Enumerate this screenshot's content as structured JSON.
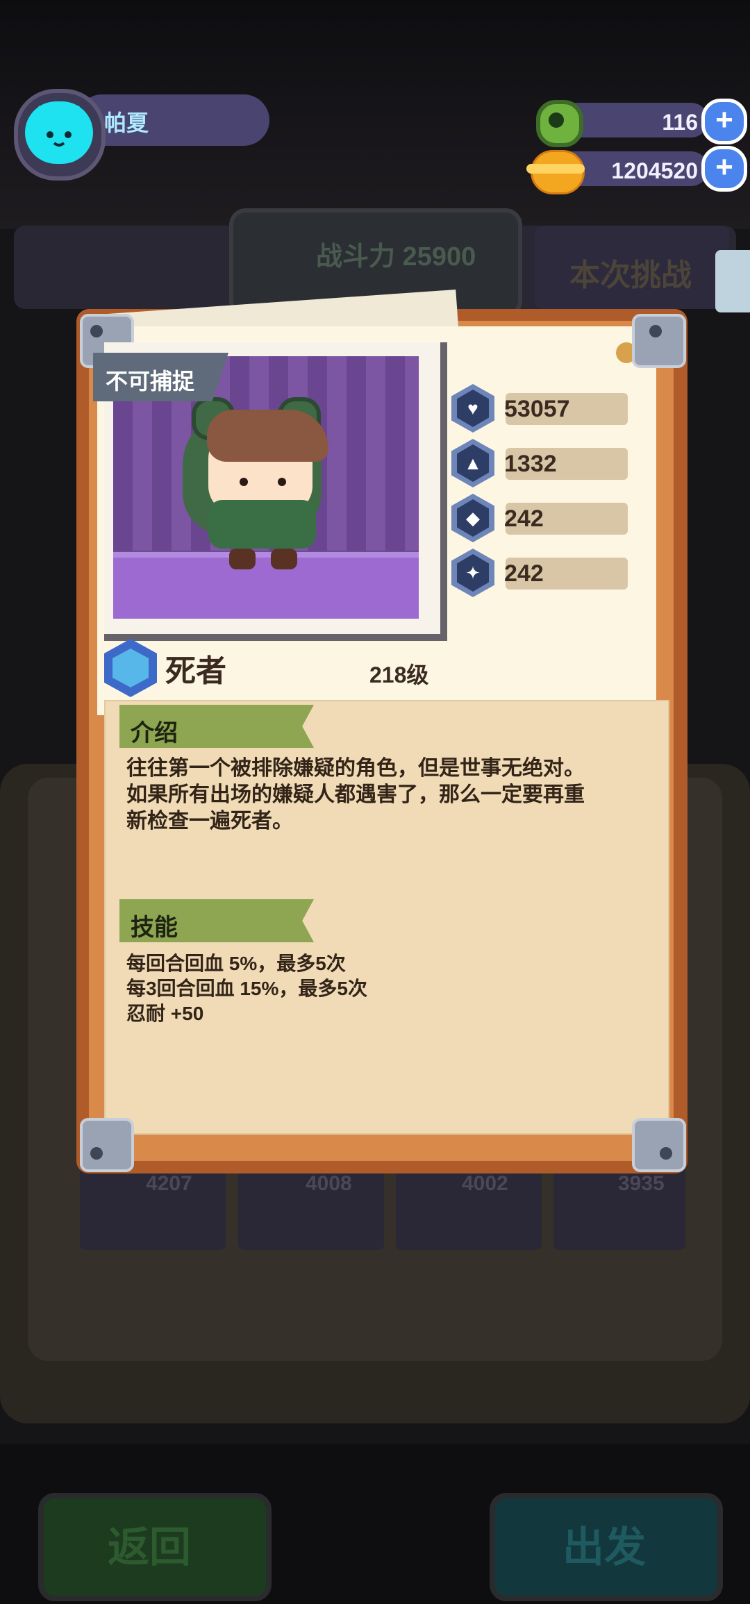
{
  "header": {
    "player_name": "帕夏",
    "currency_1_value": "116",
    "currency_2_value": "1204520",
    "add_symbol": "+"
  },
  "background": {
    "combat_power": "战斗力 25900",
    "challenge_label": "本次挑战",
    "card_numbers": [
      "4207",
      "4008",
      "4002",
      "3935"
    ],
    "back_button": "返回",
    "go_button": "出发"
  },
  "card": {
    "capture_tag": "不可捕捉",
    "stats": [
      {
        "icon": "heart-icon",
        "value": "53057"
      },
      {
        "icon": "attack-icon",
        "value": "1332"
      },
      {
        "icon": "shield-icon",
        "value": "242"
      },
      {
        "icon": "dodge-icon",
        "value": "242"
      }
    ],
    "character_name": "死者",
    "level": "218级",
    "intro_title": "介绍",
    "intro_lines": [
      "往往第一个被排除嫌疑的角色，但是世事无绝对。",
      "如果所有出场的嫌疑人都遇害了，那么一定要再重",
      "新检查一遍死者。"
    ],
    "skills_title": "技能",
    "skills": [
      "每回合回血 5%，最多5次",
      "每3回合回血 15%，最多5次",
      "忍耐 +50"
    ]
  },
  "colors": {
    "frame": "#b05c2a",
    "paper": "#f1dbb7",
    "ribbon": "#8ea552",
    "stat_hex": "#2d3d66"
  }
}
